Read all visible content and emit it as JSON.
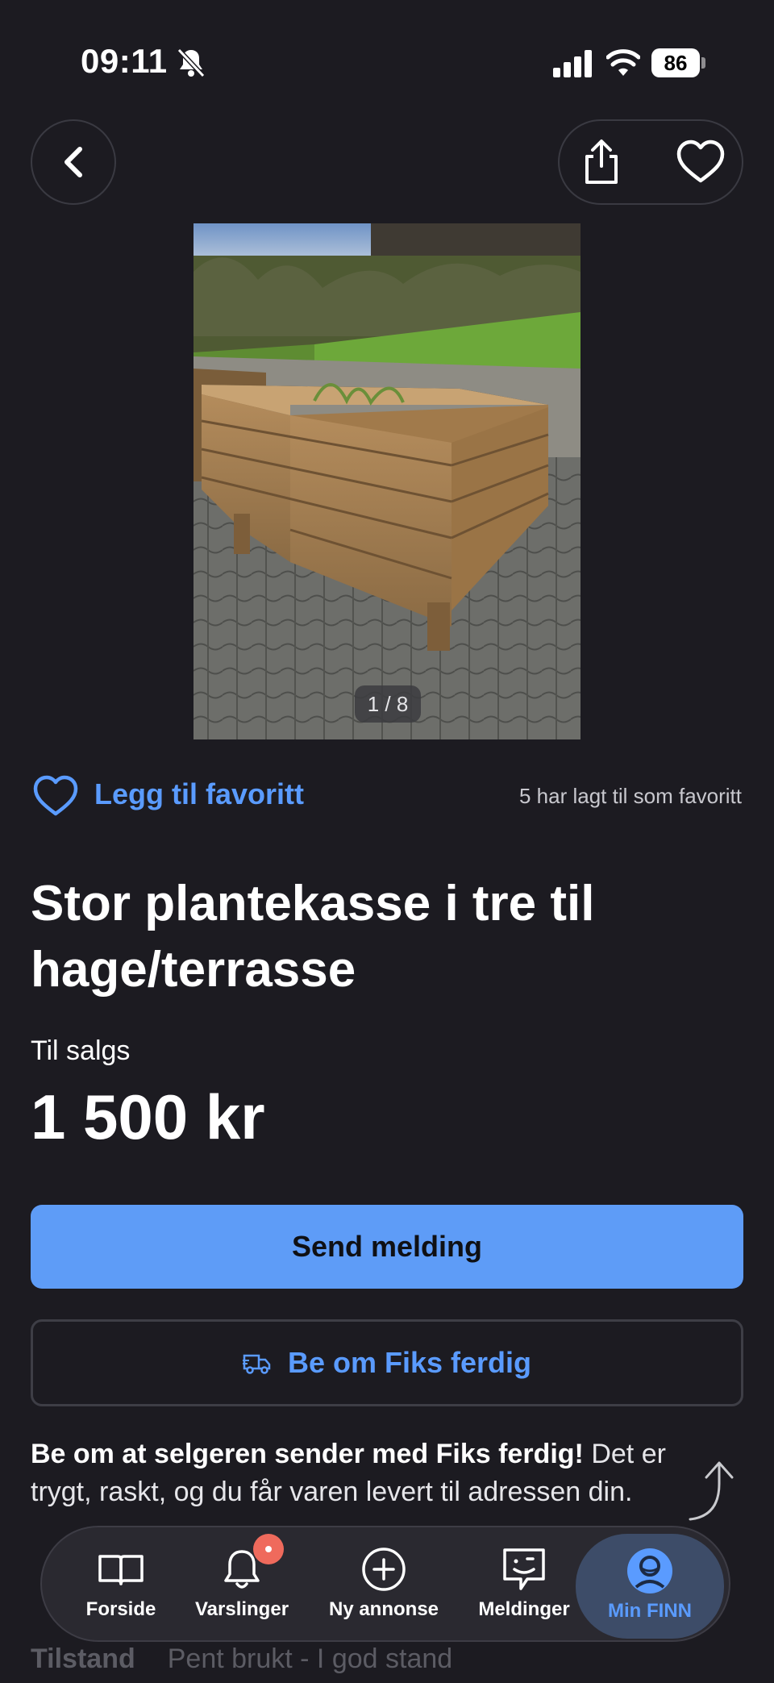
{
  "status_bar": {
    "time": "09:11",
    "battery": "86"
  },
  "gallery": {
    "counter": "1 / 8"
  },
  "favorite": {
    "label": "Legg til favoritt",
    "count_text": "5 har lagt til som favoritt"
  },
  "listing": {
    "title": "Stor plantekasse i tre til hage/terrasse",
    "type": "Til salgs",
    "price": "1 500 kr"
  },
  "actions": {
    "send_label": "Send melding",
    "fiks_label": "Be om Fiks ferdig"
  },
  "fiks_info": {
    "bold": "Be om at selgeren sender med Fiks ferdig!",
    "text": " Det er trygt, raskt, og du får varen levert til adressen din. "
  },
  "details": {
    "condition_key": "Tilstand",
    "condition_value": "Pent brukt - I god stand"
  },
  "tabs": [
    {
      "label": "Forside"
    },
    {
      "label": "Varslinger"
    },
    {
      "label": "Ny annonse"
    },
    {
      "label": "Meldinger"
    },
    {
      "label": "Min FINN"
    }
  ],
  "colors": {
    "background": "#1c1b21",
    "accent": "#5a9bff",
    "primary_button": "#5e9cf7",
    "notification": "#ef6a5c"
  }
}
